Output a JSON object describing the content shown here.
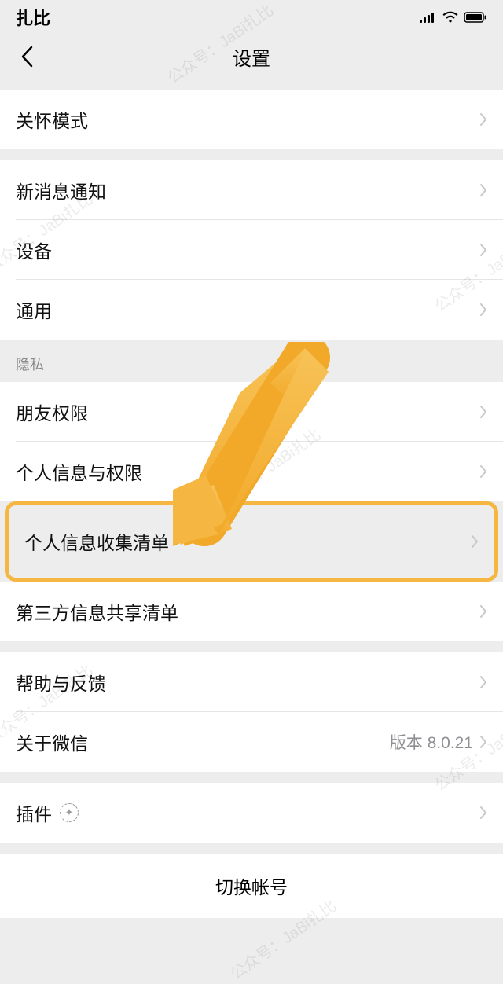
{
  "status_bar": {
    "left_text": "扎比"
  },
  "nav": {
    "title": "设置"
  },
  "rows": {
    "care_mode": "关怀模式",
    "new_msg": "新消息通知",
    "device": "设备",
    "general": "通用",
    "section_privacy": "隐私",
    "friend_perm": "朋友权限",
    "personal_info_perm": "个人信息与权限",
    "personal_info_collect": "个人信息收集清单",
    "third_party_share": "第三方信息共享清单",
    "help_feedback": "帮助与反馈",
    "about": "关于微信",
    "about_value": "版本 8.0.21",
    "plugin": "插件",
    "switch_account": "切换帐号"
  },
  "watermark": "公众号：JaBi扎比"
}
